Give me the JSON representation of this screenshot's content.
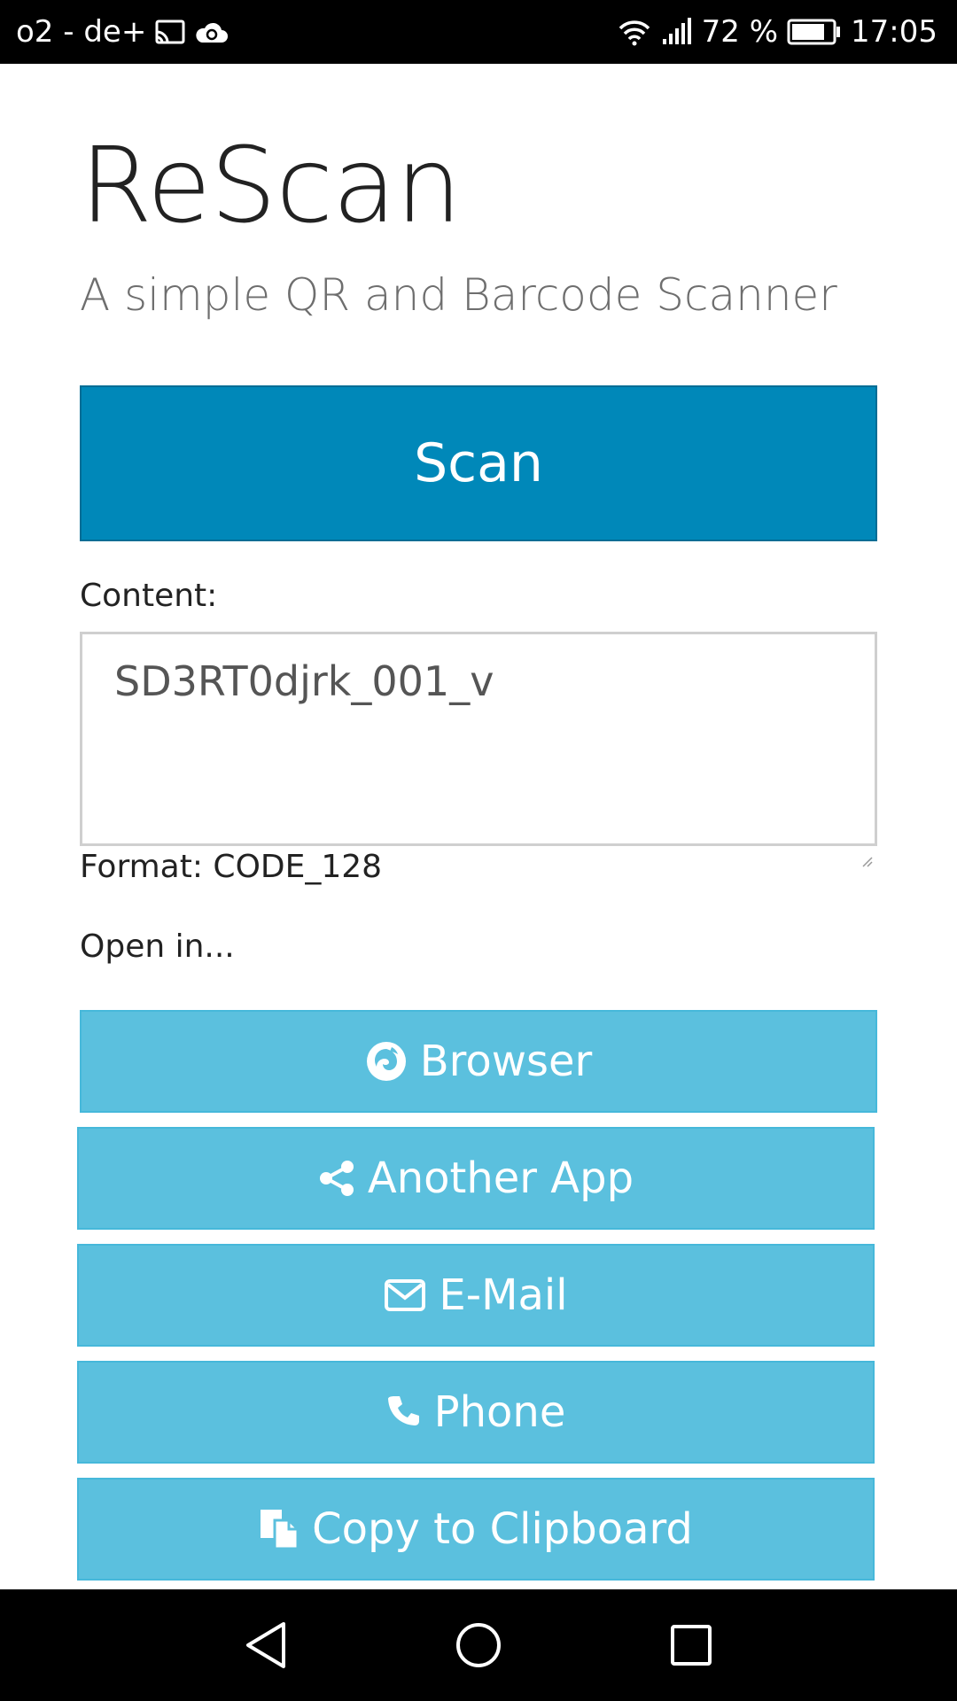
{
  "status_bar": {
    "carrier": "o2 - de+",
    "battery_percent": "72 %",
    "time": "17:05",
    "icons": [
      "cast-icon",
      "cloud-sync-icon",
      "wifi-icon",
      "signal-icon",
      "battery-icon"
    ]
  },
  "app": {
    "title": "ReScan",
    "subtitle": "A simple QR and Barcode Scanner",
    "scan_label": "Scan",
    "content_label": "Content:",
    "content_value": "SD3RT0djrk_001_v",
    "format_line": "Format: CODE_128",
    "open_in_label": "Open in..."
  },
  "actions": [
    {
      "label": "Browser",
      "icon": "firefox-icon"
    },
    {
      "label": "Another App",
      "icon": "share-icon"
    },
    {
      "label": "E-Mail",
      "icon": "envelope-icon"
    },
    {
      "label": "Phone",
      "icon": "phone-icon"
    },
    {
      "label": "Copy to Clipboard",
      "icon": "clipboard-icon"
    }
  ],
  "colors": {
    "scan_button": "#0088b9",
    "action_button": "#5bc0de",
    "status_bar": "#000000"
  },
  "nav_bar": {
    "buttons": [
      "back-icon",
      "home-icon",
      "recents-icon"
    ]
  }
}
